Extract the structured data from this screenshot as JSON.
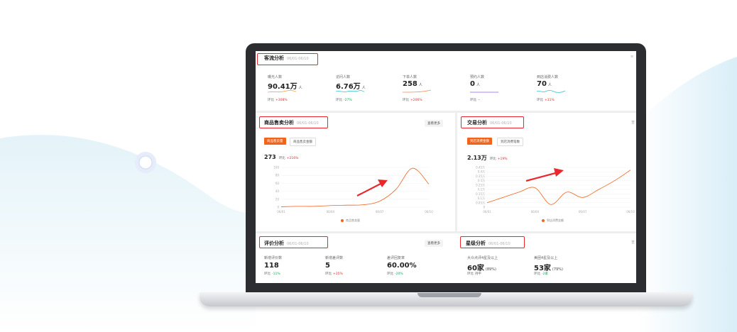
{
  "colors": {
    "accent": "#f0641e",
    "highlight": "#e8282d",
    "up": "#e8282d",
    "down": "#1aa35f"
  },
  "traffic": {
    "title": "客流分析",
    "date": "06/01-06/10",
    "metrics": [
      {
        "label": "曝光人数",
        "value": "90.41万",
        "unit": "人",
        "cmp_label": "环比",
        "change": "+308%",
        "dir": "up",
        "spark_color": "#f0a040"
      },
      {
        "label": "访问人数",
        "value": "6.76万",
        "unit": "人",
        "cmp_label": "环比",
        "change": "-27%",
        "dir": "down",
        "spark_color": "#36c5d0"
      },
      {
        "label": "下单人数",
        "value": "258",
        "unit": "人",
        "cmp_label": "环比",
        "change": "+206%",
        "dir": "up",
        "spark_color": "#f08a50"
      },
      {
        "label": "预约人数",
        "value": "0",
        "unit": "人",
        "cmp_label": "环比",
        "change": "--",
        "dir": "flat",
        "spark_color": "#8b5cf6"
      },
      {
        "label": "到店消费人数",
        "value": "70",
        "unit": "人",
        "cmp_label": "环比",
        "change": "+11%",
        "dir": "up",
        "spark_color": "#36c5d0"
      }
    ]
  },
  "sales": {
    "title": "商品售卖分析",
    "date": "06/01-06/10",
    "more": "查看更多",
    "tabs": [
      "商品售卖量",
      "商品售卖金额"
    ],
    "value": "273",
    "cmp_label": "环比",
    "change": "+216%",
    "legend": "商品售卖量",
    "chart_data": {
      "type": "line",
      "x": [
        "06/01",
        "06/02",
        "06/03",
        "06/04",
        "06/05",
        "06/06",
        "06/07",
        "06/08",
        "06/09",
        "06/10"
      ],
      "y_ticks": [
        "100",
        "80",
        "60",
        "40",
        "20",
        "0"
      ],
      "x_ticks": [
        "06/01",
        "06/04",
        "06/07",
        "06/10"
      ],
      "series": [
        {
          "name": "商品售卖量",
          "values": [
            1,
            2,
            2,
            4,
            5,
            6,
            15,
            45,
            98,
            58
          ]
        }
      ],
      "ylim": [
        0,
        100
      ]
    }
  },
  "trade": {
    "title": "交易分析",
    "date": "06/01-06/10",
    "edge": "查",
    "tabs": [
      "到店消费金额",
      "到店消费笔数"
    ],
    "value": "2.13万",
    "cmp_label": "环比",
    "change": "+19%",
    "legend": "到店消费金额",
    "chart_data": {
      "type": "line",
      "x": [
        "06/01",
        "06/02",
        "06/03",
        "06/04",
        "06/05",
        "06/06",
        "06/07",
        "06/08",
        "06/09",
        "06/10"
      ],
      "y_ticks": [
        "0.45万",
        "0.4万",
        "0.35万",
        "0.3万",
        "0.25万",
        "0.2万",
        "0.15万",
        "0.1万",
        "0.05万",
        "0"
      ],
      "x_ticks": [
        "06/01",
        "06/04",
        "06/07",
        "06/10"
      ],
      "series": [
        {
          "name": "到店消费金额",
          "values": [
            500,
            1100,
            1700,
            2200,
            300,
            1700,
            1100,
            2000,
            3000,
            4200
          ]
        }
      ],
      "ylim": [
        0,
        4500
      ]
    }
  },
  "review": {
    "title": "评价分析",
    "date": "06/01-06/10",
    "more": "查看更多",
    "metrics": [
      {
        "label": "新增评价数",
        "value": "118",
        "cmp_label": "环比",
        "change": "-11%",
        "dir": "down"
      },
      {
        "label": "新增差评数",
        "value": "5",
        "cmp_label": "环比",
        "change": "+25%",
        "dir": "up"
      },
      {
        "label": "差评回复率",
        "value": "60.00%",
        "cmp_label": "环比",
        "change": "-20%",
        "dir": "down"
      }
    ]
  },
  "rating": {
    "title": "星级分析",
    "date": "06/01-06/10",
    "edge": "查",
    "metrics": [
      {
        "label": "大众点评4星及以上",
        "value": "60家",
        "pct": "(89%)",
        "cmp_label": "环比",
        "change": "持平",
        "dir": "flat"
      },
      {
        "label": "美团4星及以上",
        "value": "53家",
        "pct": "(79%)",
        "cmp_label": "环比",
        "change": "-2家",
        "dir": "down"
      }
    ]
  }
}
